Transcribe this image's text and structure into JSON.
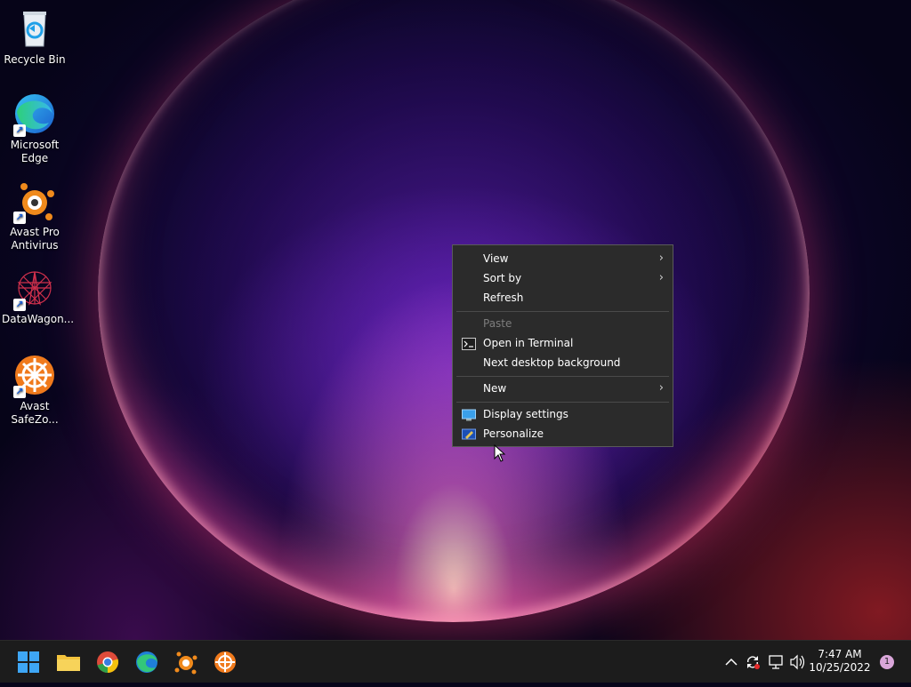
{
  "desktop": {
    "icons": [
      {
        "label": "Recycle Bin",
        "icon": "recycle-bin-icon"
      },
      {
        "label": "Microsoft Edge",
        "icon": "edge-icon"
      },
      {
        "label": "Avast Pro Antivirus",
        "icon": "avast-icon"
      },
      {
        "label": "DataWagon...",
        "icon": "datawagon-icon"
      },
      {
        "label": "Avast SafeZo...",
        "icon": "avast-safezone-icon"
      }
    ]
  },
  "context_menu": {
    "items": [
      {
        "label": "View",
        "has_submenu": true
      },
      {
        "label": "Sort by",
        "has_submenu": true
      },
      {
        "label": "Refresh"
      },
      {
        "label": "Paste",
        "disabled": true
      },
      {
        "label": "Open in Terminal",
        "icon": "terminal-icon"
      },
      {
        "label": "Next desktop background"
      },
      {
        "label": "New",
        "has_submenu": true
      },
      {
        "label": "Display settings",
        "icon": "display-icon"
      },
      {
        "label": "Personalize",
        "icon": "personalize-icon"
      }
    ]
  },
  "taskbar": {
    "apps": [
      "start-icon",
      "file-explorer-icon",
      "chrome-icon",
      "edge-icon",
      "avast-icon",
      "avast-safezone-icon"
    ],
    "tray": {
      "time": "7:47 AM",
      "date": "10/25/2022",
      "notification_count": "1"
    }
  },
  "colors": {
    "menu_bg": "#2b2b2b",
    "taskbar_bg": "#1c1c1c",
    "accent": "#0078d4"
  }
}
